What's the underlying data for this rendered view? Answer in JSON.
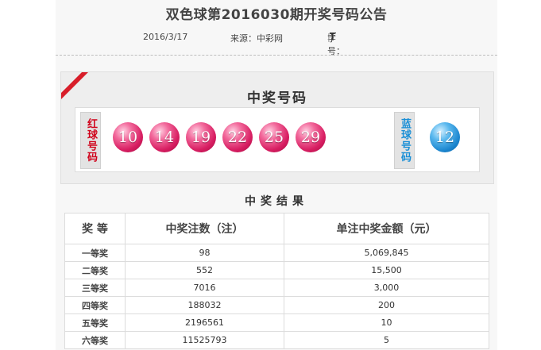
{
  "header": {
    "title": "双色球第2016030期开奖号码公告",
    "date": "2016/3/17",
    "source": "来源：中彩网",
    "font_size_label": "字号：",
    "font_size_options": [
      "T",
      "T",
      "T"
    ]
  },
  "winning_numbers": {
    "title": "中奖号码",
    "red_label": "红球号码",
    "blue_label": "蓝球号码",
    "red_balls": [
      "10",
      "14",
      "19",
      "22",
      "25",
      "29"
    ],
    "blue_ball": "12"
  },
  "results": {
    "title": "中奖结果",
    "headers": [
      "奖 等",
      "中奖注数（注）",
      "单注中奖金额（元）"
    ],
    "rows": [
      {
        "rank": "一等奖",
        "count": "98",
        "amount": "5,069,845"
      },
      {
        "rank": "二等奖",
        "count": "552",
        "amount": "15,500"
      },
      {
        "rank": "三等奖",
        "count": "7016",
        "amount": "3,000"
      },
      {
        "rank": "四等奖",
        "count": "188032",
        "amount": "200"
      },
      {
        "rank": "五等奖",
        "count": "2196561",
        "amount": "10"
      },
      {
        "rank": "六等奖",
        "count": "11525793",
        "amount": "5"
      }
    ]
  },
  "colors": {
    "accent_red": "#d81e2a",
    "red_ball": "#d81e62",
    "blue_ball": "#1c86cf",
    "red_label_text": "#d0021b",
    "blue_label_text": "#1a8fd6"
  }
}
